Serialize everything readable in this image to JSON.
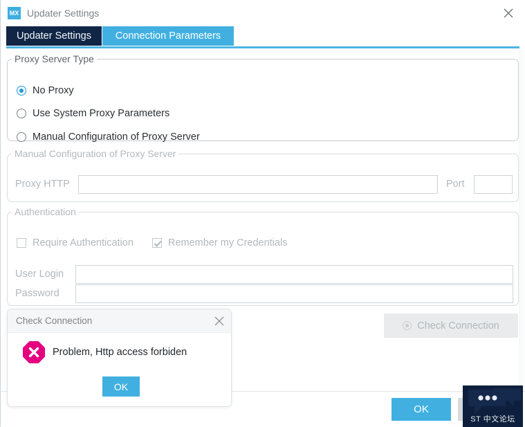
{
  "window": {
    "app_icon_text": "MX",
    "title": "Updater Settings",
    "close_icon": "close-icon"
  },
  "tabs": [
    {
      "label": "Updater Settings",
      "state": "inactive-dark"
    },
    {
      "label": "Connection Parameters",
      "state": "active"
    }
  ],
  "proxy_type_group": {
    "title": "Proxy Server Type",
    "options": [
      {
        "label": "No Proxy",
        "selected": true
      },
      {
        "label": "Use System Proxy Parameters",
        "selected": false
      },
      {
        "label": "Manual Configuration of Proxy Server",
        "selected": false
      }
    ]
  },
  "manual_group": {
    "title": "Manual Configuration of Proxy Server",
    "proxy_http_label": "Proxy HTTP",
    "proxy_http_value": "",
    "proxy_http_placeholder": "",
    "port_label": "Port",
    "port_value": "",
    "port_placeholder": "",
    "enabled": false
  },
  "auth_group": {
    "title": "Authentication",
    "require_auth_label": "Require Authentication",
    "require_auth_checked": false,
    "remember_label": "Remember my Credentials",
    "remember_checked": true,
    "user_login_label": "User Login",
    "user_login_value": "",
    "user_login_placeholder": "",
    "password_label": "Password",
    "password_value": "",
    "password_placeholder": "",
    "enabled": false
  },
  "check_connection_button": {
    "label": "Check Connection",
    "icon": "connection-status-icon",
    "enabled": false
  },
  "footer": {
    "ok_label": "OK",
    "cancel_label": ""
  },
  "modal": {
    "title": "Check Connection",
    "close_icon": "close-icon",
    "error_icon": "error-octagon-icon",
    "message": "Problem, Http access forbiden",
    "ok_label": "OK"
  },
  "watermark": {
    "text": "ST 中文论坛",
    "icon": "speech-bubbles-icon"
  },
  "colors": {
    "accent_blue": "#41b0e1",
    "tab_dark": "#112647",
    "error_magenta": "#e4007f",
    "disabled_grey": "#b2b8bc",
    "watermark_navy": "#0d1f3c"
  }
}
